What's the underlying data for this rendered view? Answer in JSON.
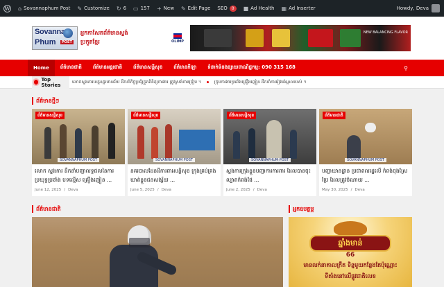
{
  "adminbar": {
    "site_name": "Sovannaphum Post",
    "customize": "Customize",
    "updates_count": "6",
    "comments_count": "157",
    "new_label": "New",
    "edit_page": "Edit Page",
    "seo_label": "SEO",
    "seo_count": "0",
    "ad_health": "Ad Health",
    "ad_inserter": "Ad Inserter",
    "howdy": "Howdy, Deva"
  },
  "header": {
    "logo_line1": "Sovanna",
    "logo_line2": "Phum",
    "logo_badge": "POST",
    "logo_khmer": "អ្នកកាសែតព័ត៌មានស្ទង់ប្រកួតខ្មែរ",
    "banner_brand": "OLIMP",
    "banner_tagline": "NEW BALANCING FLAVOR"
  },
  "nav": {
    "items": [
      {
        "label": "Home",
        "active": true
      },
      {
        "label": "ព័ត៌មានជាតិ"
      },
      {
        "label": "ព័ត៌មានអន្តរជាតិ"
      },
      {
        "label": "ព័ត៌មានសន្តិសុខ"
      },
      {
        "label": "ព័ត៌មានកីឡា"
      },
      {
        "label": "ទំនាក់ទំនងផ្សាយពាណិជ្ជកម្ម: 090 315 168"
      }
    ],
    "search_icon": "search-icon"
  },
  "ticker": {
    "label": "Top Stories",
    "items": [
      "លោកស្នងការខេត្តឧត្តរមានជ័យ ដឹកនាំកិច្ចប្រជុំត្រួតពិនិត្យការងារ ត្រូវស្រង់ការត្រៀម ។",
      "ក្រុមការងារប្រឆាំងគ្រឿងញៀន ដឹកនាំការរៀងរណ្ដែលរបស់ ។"
    ]
  },
  "latest": {
    "heading": "ព័ត៌មានថ្មីៗ",
    "cards": [
      {
        "badge": "ព័ត៌មានសន្តិសុខ",
        "title": "លោក ស្នងការ ដឹកនាំបញ្ជាលទ្ធផលនៃការ ប្រយុទ្ធប្រឆាំង បទល្មើស គ្រឿងញៀន ...",
        "date": "June 12, 2025",
        "author": "Deva",
        "watermark": "SOVANNAPHUM POST"
      },
      {
        "badge": "ព័ត៌មានសន្តិសុខ",
        "title": "នគរបាលដែនដីការពារសន្តិសុខ ក្រុងគ្រប់គ្រង ឃាត់ខ្លួនជនសង្ស័យ ...",
        "date": "June 5, 2025",
        "author": "Deva",
        "watermark": "SOVANNAPHUM POST"
      },
      {
        "badge": "ព័ត៌មានសន្តិសុខ",
        "title": "ស្នងការក្រុងខ្លួនបញ្ជាការការពារ ដែលបានចុះល្បាតកំពង់ផែ ...",
        "date": "June 2, 2025",
        "author": "Deva",
        "watermark": "SOVANNAPHUM POST"
      },
      {
        "badge": "ព័ត៌មានជាតិ",
        "title": "បញ្ហាយានដ្ឋាន ប្រជាពលរដ្ឋលើ កំពង់ចុងស្រែប្រែ ដែលត្រូវចំណាយ ...",
        "date": "May 30, 2025",
        "author": "Deva",
        "watermark": "SOVANNAPHUM POST"
      }
    ]
  },
  "national": {
    "heading": "ព័ត៌មានជាតិ"
  },
  "sidebar": {
    "heading": "អ្នកឧបត្ថម្ភ",
    "ad_brand": "ឆ្នាំងមាន់",
    "ad_number": "66",
    "ad_line1": "មានលក់នាគាលក្រឹត ទិន្នមួយកន្លែងតែប៉ុណ្ណោះ",
    "ad_line2": "ទីតាំងនៅលើផ្លូវជាតិលេខ"
  },
  "colors": {
    "accent": "#e60000",
    "admin_bar": "#1d2327",
    "nav_active": "#b80000"
  }
}
